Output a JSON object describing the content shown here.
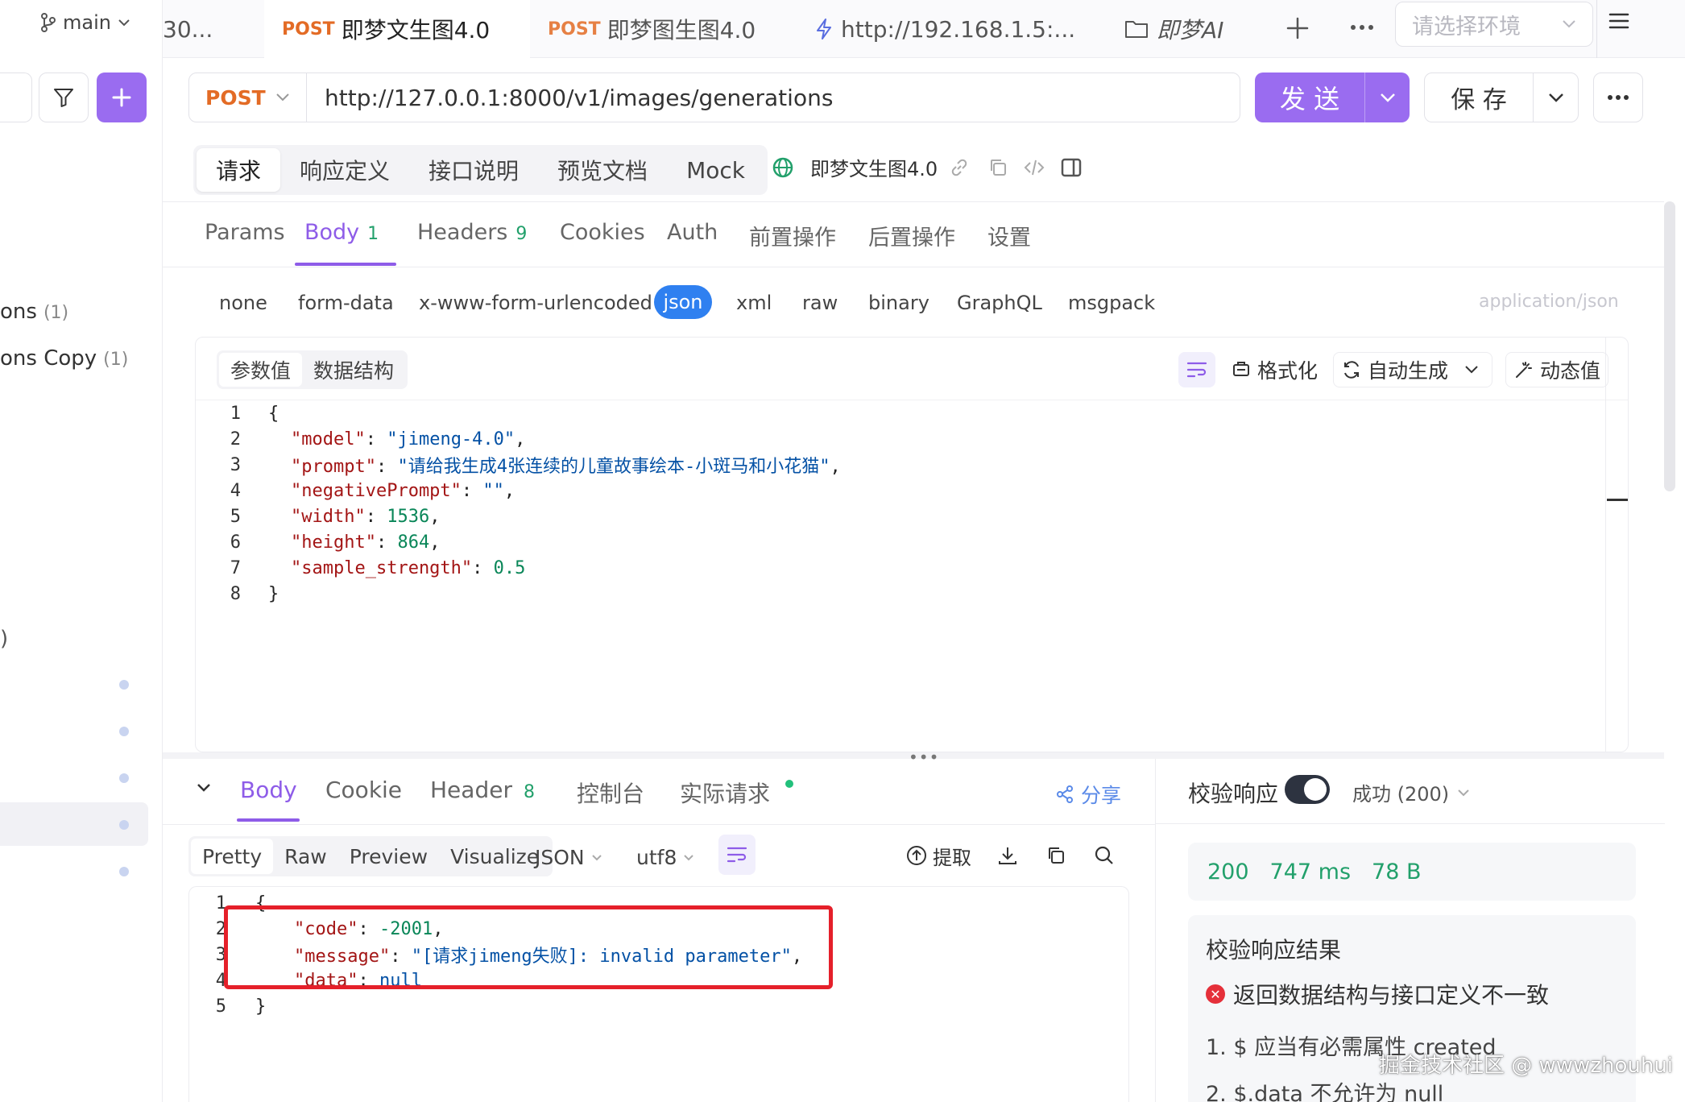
{
  "sidebar": {
    "branch": "main",
    "items": [
      {
        "label": "ons",
        "count": "(1)"
      },
      {
        "label": "ons Copy",
        "count": "(1)"
      }
    ],
    "stray": ")"
  },
  "tabs": [
    {
      "label": "30..."
    },
    {
      "method": "POST",
      "label": "即梦文生图4.0"
    },
    {
      "method": "POST",
      "label": "即梦图生图4.0"
    },
    {
      "label": "http://192.168.1.5:..."
    },
    {
      "label": "即梦AI"
    }
  ],
  "environment": {
    "placeholder": "请选择环境"
  },
  "request": {
    "method": "POST",
    "url": "http://127.0.0.1:8000/v1/images/generations",
    "send_label": "发 送",
    "save_label": "保 存"
  },
  "segments": [
    "请求",
    "响应定义",
    "接口说明",
    "预览文档",
    "Mock"
  ],
  "api_name": "即梦文生图4.0",
  "param_tabs": [
    {
      "label": "Params"
    },
    {
      "label": "Body",
      "count": "1"
    },
    {
      "label": "Headers",
      "count": "9"
    },
    {
      "label": "Cookies"
    },
    {
      "label": "Auth"
    },
    {
      "label": "前置操作"
    },
    {
      "label": "后置操作"
    },
    {
      "label": "设置"
    }
  ],
  "body_types": [
    "none",
    "form-data",
    "x-www-form-urlencoded",
    "json",
    "xml",
    "raw",
    "binary",
    "GraphQL",
    "msgpack"
  ],
  "content_type": "application/json",
  "editor_modes": [
    "参数值",
    "数据结构"
  ],
  "editor_tools": {
    "format": "格式化",
    "auto": "自动生成",
    "dynamic": "动态值"
  },
  "request_body_lines": [
    {
      "n": "1",
      "parts": [
        [
          "p",
          "{"
        ]
      ]
    },
    {
      "n": "2",
      "parts": [
        [
          "k",
          "\"model\""
        ],
        [
          "p",
          ": "
        ],
        [
          "s",
          "\"jimeng-4.0\""
        ],
        [
          "p",
          ","
        ]
      ]
    },
    {
      "n": "3",
      "parts": [
        [
          "k",
          "\"prompt\""
        ],
        [
          "p",
          ": "
        ],
        [
          "s",
          "\"请给我生成4张连续的儿童故事绘本-小斑马和小花猫\""
        ],
        [
          "p",
          ","
        ]
      ]
    },
    {
      "n": "4",
      "parts": [
        [
          "k",
          "\"negativePrompt\""
        ],
        [
          "p",
          ": "
        ],
        [
          "s",
          "\"\""
        ],
        [
          "p",
          ","
        ]
      ]
    },
    {
      "n": "5",
      "parts": [
        [
          "k",
          "\"width\""
        ],
        [
          "p",
          ": "
        ],
        [
          "n",
          "1536"
        ],
        [
          "p",
          ","
        ]
      ]
    },
    {
      "n": "6",
      "parts": [
        [
          "k",
          "\"height\""
        ],
        [
          "p",
          ": "
        ],
        [
          "n",
          "864"
        ],
        [
          "p",
          ","
        ]
      ]
    },
    {
      "n": "7",
      "parts": [
        [
          "k",
          "\"sample_strength\""
        ],
        [
          "p",
          ": "
        ],
        [
          "n",
          "0.5"
        ]
      ]
    },
    {
      "n": "8",
      "parts": [
        [
          "p",
          "}"
        ]
      ]
    }
  ],
  "response_tabs": [
    {
      "label": "Body"
    },
    {
      "label": "Cookie"
    },
    {
      "label": "Header",
      "count": "8"
    },
    {
      "label": "控制台"
    },
    {
      "label": "实际请求"
    }
  ],
  "share_label": "分享",
  "response_modes": [
    "Pretty",
    "Raw",
    "Preview",
    "Visualize"
  ],
  "response_format": "JSON",
  "response_encoding": "utf8",
  "extract_label": "提取",
  "response_body_lines": [
    {
      "n": "1",
      "parts": [
        [
          "p",
          "{"
        ]
      ]
    },
    {
      "n": "2",
      "parts": [
        [
          "k",
          "\"code\""
        ],
        [
          "p",
          ": "
        ],
        [
          "n",
          "-2001"
        ],
        [
          "p",
          ","
        ]
      ]
    },
    {
      "n": "3",
      "parts": [
        [
          "k",
          "\"message\""
        ],
        [
          "p",
          ": "
        ],
        [
          "s",
          "\"[请求jimeng失败]: invalid parameter\""
        ],
        [
          "p",
          ","
        ]
      ]
    },
    {
      "n": "4",
      "parts": [
        [
          "k",
          "\"data\""
        ],
        [
          "p",
          ": "
        ],
        [
          "s",
          "null"
        ]
      ]
    },
    {
      "n": "5",
      "parts": [
        [
          "p",
          "}"
        ]
      ]
    }
  ],
  "validation": {
    "title": "校验响应",
    "status": "成功 (200)",
    "code": "200",
    "time": "747 ms",
    "size": "78 B",
    "result_title": "校验响应结果",
    "error": "返回数据结构与接口定义不一致",
    "items": [
      "1. $ 应当有必需属性 created",
      "2. $.data 不允许为 null"
    ]
  },
  "watermark": "掘金技术社区 @ wwwzhouhui",
  "colors": {
    "accent": "#8e5ce8",
    "send": "#9a6cf0",
    "post": "#e36b25",
    "success": "#22a06b",
    "error": "#e5202a",
    "json_active": "#2f80f0"
  }
}
